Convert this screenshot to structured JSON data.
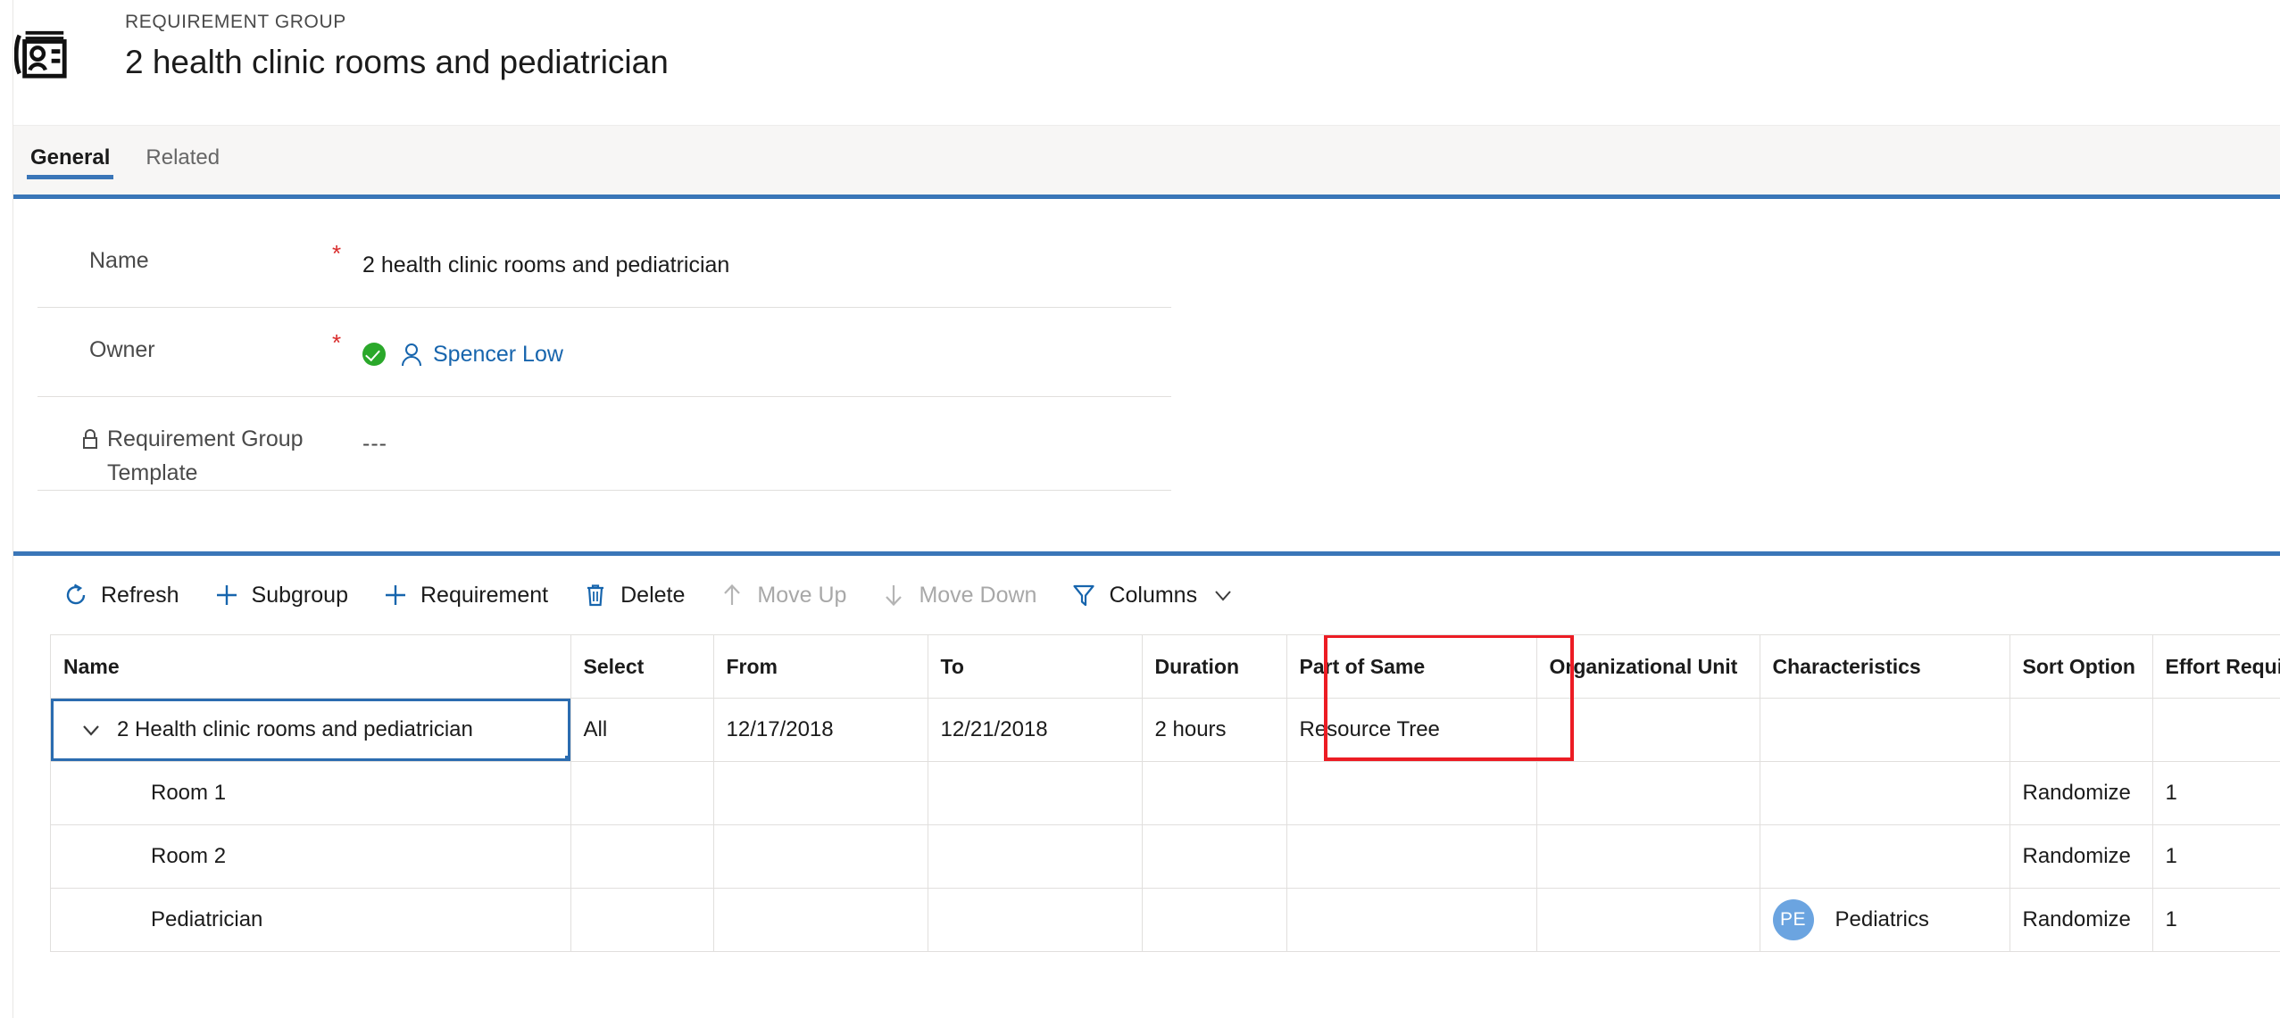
{
  "header": {
    "entity_type": "REQUIREMENT GROUP",
    "record_title": "2 health clinic rooms and pediatrician",
    "icon": "requirement-group-card-icon"
  },
  "tabs": [
    {
      "label": "General",
      "active": true
    },
    {
      "label": "Related",
      "active": false
    }
  ],
  "form": {
    "fields": [
      {
        "label": "Name",
        "required_marker": "*",
        "value": "2 health clinic rooms and pediatrician",
        "locked": false,
        "type": "text"
      },
      {
        "label": "Owner",
        "required_marker": "*",
        "value": "Spencer Low",
        "locked": false,
        "type": "lookup",
        "status_icon": "green-check-icon",
        "person_icon": "person-icon"
      },
      {
        "label": "Requirement Group Template",
        "required_marker": "",
        "value": "---",
        "locked": true,
        "lock_icon": "lock-icon",
        "type": "text"
      }
    ]
  },
  "toolbar": {
    "commands": [
      {
        "label": "Refresh",
        "icon": "refresh-icon",
        "disabled": false
      },
      {
        "label": "Subgroup",
        "icon": "plus-icon",
        "disabled": false
      },
      {
        "label": "Requirement",
        "icon": "plus-icon",
        "disabled": false
      },
      {
        "label": "Delete",
        "icon": "trash-icon",
        "disabled": false
      },
      {
        "label": "Move Up",
        "icon": "arrow-up-icon",
        "disabled": true
      },
      {
        "label": "Move Down",
        "icon": "arrow-down-icon",
        "disabled": true
      },
      {
        "label": "Columns",
        "icon": "filter-icon",
        "disabled": false,
        "has_caret": true
      }
    ]
  },
  "grid": {
    "columns": [
      "Name",
      "Select",
      "From",
      "To",
      "Duration",
      "Part of Same",
      "Organizational Unit",
      "Characteristics",
      "Sort Option",
      "Effort Require"
    ],
    "rows": [
      {
        "name": "2 Health clinic rooms and pediatrician",
        "expander": "chevron-down-icon",
        "indent": 0,
        "selected": true,
        "select": "All",
        "from": "12/17/2018",
        "to": "12/21/2018",
        "duration": "2 hours",
        "part_of_same": "Resource Tree",
        "organizational_unit": "",
        "characteristic": "",
        "characteristic_initials": "",
        "sort_option": "",
        "effort_required": ""
      },
      {
        "name": "Room 1",
        "expander": "",
        "indent": 1,
        "selected": false,
        "select": "",
        "from": "",
        "to": "",
        "duration": "",
        "part_of_same": "",
        "organizational_unit": "",
        "characteristic": "",
        "characteristic_initials": "",
        "sort_option": "Randomize",
        "effort_required": "1"
      },
      {
        "name": "Room 2",
        "expander": "",
        "indent": 1,
        "selected": false,
        "select": "",
        "from": "",
        "to": "",
        "duration": "",
        "part_of_same": "",
        "organizational_unit": "",
        "characteristic": "",
        "characteristic_initials": "",
        "sort_option": "Randomize",
        "effort_required": "1"
      },
      {
        "name": "Pediatrician",
        "expander": "",
        "indent": 1,
        "selected": false,
        "select": "",
        "from": "",
        "to": "",
        "duration": "",
        "part_of_same": "",
        "organizational_unit": "",
        "characteristic": "Pediatrics",
        "characteristic_initials": "PE",
        "sort_option": "Randomize",
        "effort_required": "1"
      }
    ]
  },
  "annotation": {
    "target_column": "Part of Same",
    "color": "#ec1c24"
  },
  "colors": {
    "accent": "#3a76b8",
    "link": "#1765ad",
    "required": "#d92b2b",
    "success": "#2aa82a",
    "selection": "#2b6cb0",
    "avatar": "#6ba4e0",
    "annotation": "#ec1c24",
    "tab_bg": "#f7f6f5"
  }
}
